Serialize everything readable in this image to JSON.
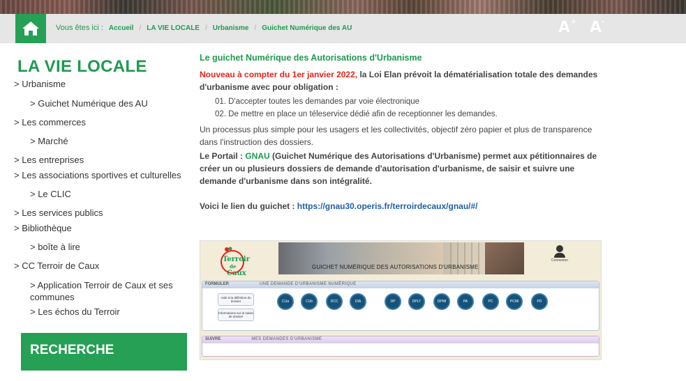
{
  "breadcrumb": {
    "label": "Vous êtes ici :",
    "items": [
      "Accueil",
      "LA VIE LOCALE",
      "Urbanisme",
      "Guichet Numérique des AU"
    ],
    "separator": "/"
  },
  "text_size": {
    "increase": "A",
    "decrease": "A",
    "plus": "+",
    "minus": "-"
  },
  "sidebar": {
    "title": "LA VIE LOCALE",
    "items": [
      {
        "label": "> Urbanisme",
        "level": 1
      },
      {
        "label": "> Guichet Numérique des AU",
        "level": 2
      },
      {
        "label": "> Les commerces",
        "level": 1
      },
      {
        "label": "> Marché",
        "level": 2
      },
      {
        "label": "> Les entreprises",
        "level": 1
      },
      {
        "label": "> Les associations sportives et culturelles",
        "level": 1
      },
      {
        "label": "> Le CLIC",
        "level": 2
      },
      {
        "label": "> Les services publics",
        "level": 1
      },
      {
        "label": "> Bibliothèque",
        "level": 1
      },
      {
        "label": "> boîte à lire",
        "level": 2
      },
      {
        "label": "> CC Terroir de Caux",
        "level": 1
      },
      {
        "label": "> Application Terroir de Caux et ses communes",
        "level": 2
      },
      {
        "label": "> Les échos du Terroir",
        "level": 2
      }
    ],
    "search_label": "RECHERCHE"
  },
  "main": {
    "title": "Le guichet Numérique des Autorisations d'Urbanisme",
    "intro_red": "Nouveau à compter du 1er janvier 2022,",
    "intro_rest": " la Loi Elan prévoit la dématérialisation totale des demandes d'urbanisme avec pour obligation :",
    "list": [
      "01. D'accepter toutes les demandes par voie électronique",
      "02. De mettre en place un téleservice dédié afin de receptionner les demandes."
    ],
    "process": "Un processus plus simple pour les usagers et les collectivités, objectif zéro papier et plus de transparence dans l'instruction des dossiers.",
    "portal_prefix": "Le Portail : ",
    "portal_name": "GNAU",
    "portal_rest": " (Guichet Numérique des Autorisations d'Urbanisme)  permet aux pétitionnaires de créer un ou plusieurs dossiers de demande d'autorisation d'urbanisme, de saisir et suivre une demande d'urbanisme dans son intégralité.",
    "link_prefix": "Voici le lien du guichet : ",
    "link_url": "https://gnau30.operis.fr/terroirdecaux/gnau/#/"
  },
  "screenshot": {
    "logo_line1": "Terroir",
    "logo_line2": "de",
    "logo_line3": "Caux",
    "banner_title": "GUICHET NUMÉRIQUE DES AUTORISATIONS D'URBANISME",
    "user_label": "Connexion",
    "panel1_title": "FORMULER",
    "panel1_sub": "UNE DEMANDE D'URBANISME NUMÉRIQUE",
    "help_btn1": "Aide à la définition du dossier",
    "help_btn2": "Informations sur la saisie de dossier",
    "circles": [
      "CUa",
      "CUb",
      "DCC",
      "DIA",
      "DP",
      "DPLT",
      "DPMI",
      "PA",
      "PC",
      "PCMI",
      "PD"
    ],
    "panel2_title": "SUIVRE",
    "panel2_sub": "MES DEMANDES D'URBANISME"
  },
  "colors": {
    "accent": "#25a055",
    "red": "#e3241b",
    "link": "#1f5fa8"
  }
}
